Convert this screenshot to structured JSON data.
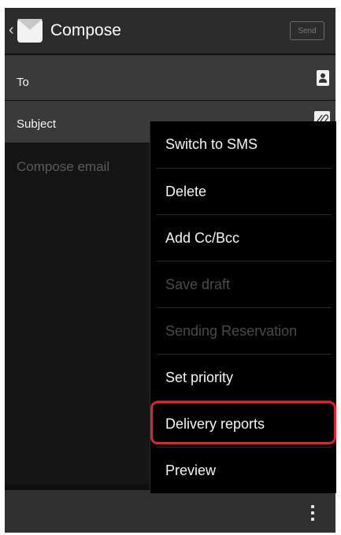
{
  "app_bar": {
    "title": "Compose",
    "send_label": "Send",
    "back_icon": "chevron-left-icon",
    "app_icon": "email-icon"
  },
  "fields": {
    "to_label": "To",
    "subject_label": "Subject",
    "contact_icon": "contact-icon",
    "attach_icon": "paperclip-icon"
  },
  "body": {
    "placeholder": "Compose email"
  },
  "menu": {
    "items": [
      {
        "label": "Switch to SMS",
        "enabled": true
      },
      {
        "label": "Delete",
        "enabled": true
      },
      {
        "label": "Add Cc/Bcc",
        "enabled": true
      },
      {
        "label": "Save draft",
        "enabled": false
      },
      {
        "label": "Sending Reservation",
        "enabled": false
      },
      {
        "label": "Set priority",
        "enabled": true
      },
      {
        "label": "Delivery reports",
        "enabled": true,
        "highlighted": true
      },
      {
        "label": "Preview",
        "enabled": true
      }
    ],
    "highlight_color": "#e8202a"
  },
  "bottom_bar": {
    "overflow_icon": "overflow-menu-icon"
  },
  "colors": {
    "app_bar": "#2c2c2c",
    "field_bg": "#3a3a3a",
    "menu_bg": "#000000"
  }
}
